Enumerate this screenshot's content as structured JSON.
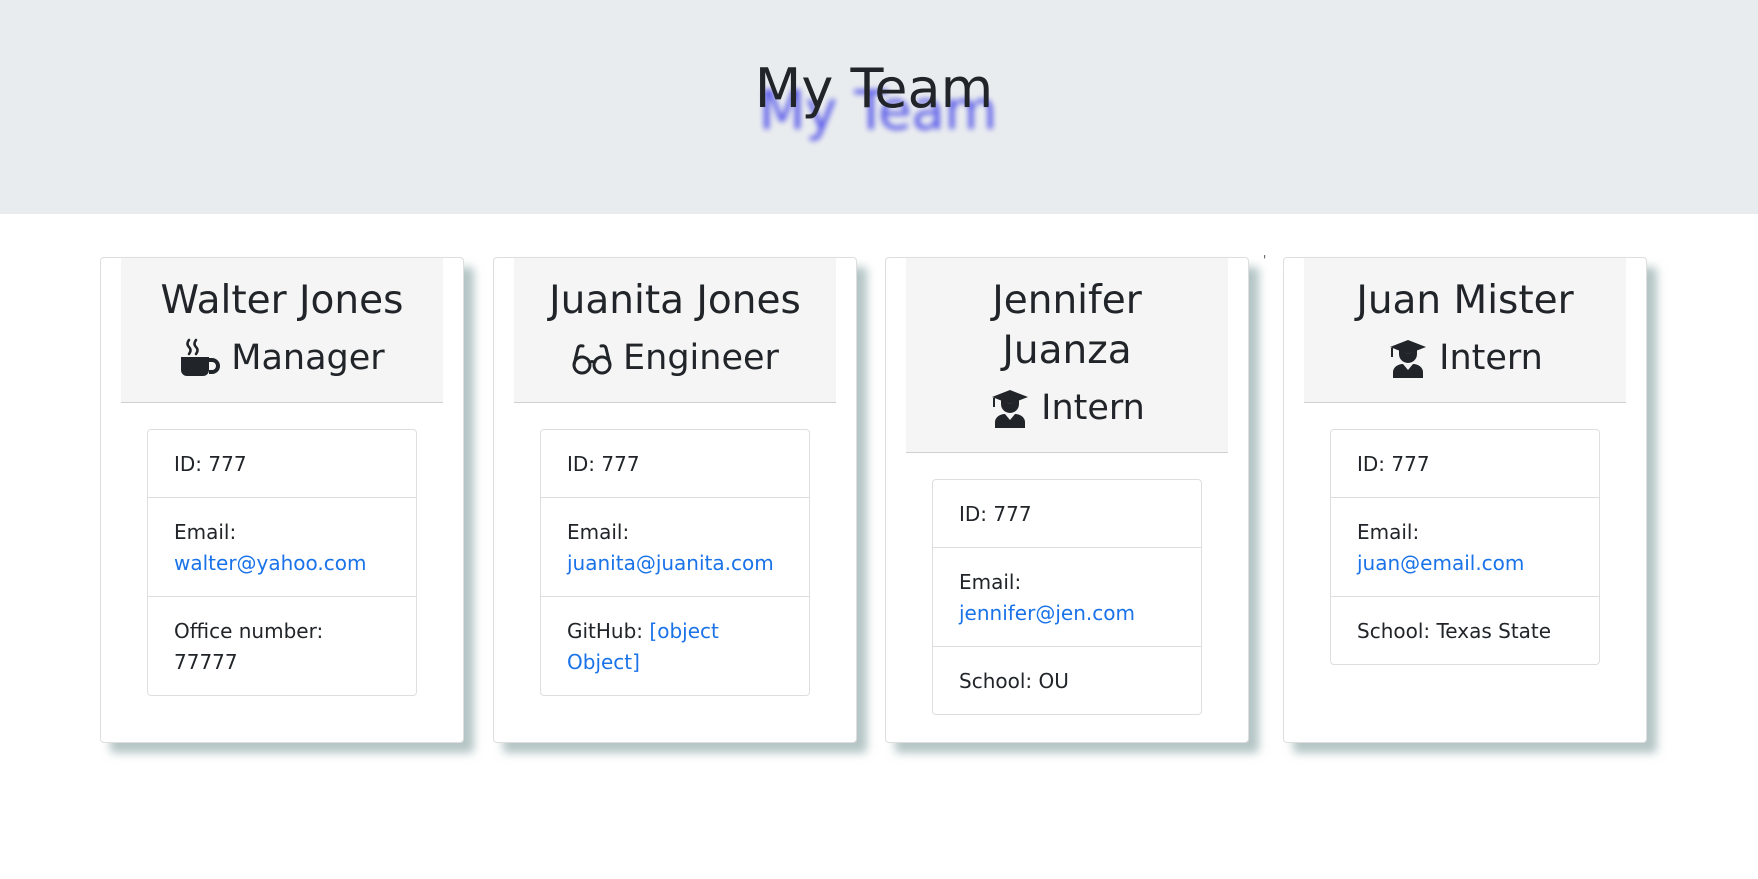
{
  "header": {
    "title": "My Team"
  },
  "employees": [
    {
      "name": "Walter Jones",
      "role": "Manager",
      "role_icon": "mug-hot-icon",
      "id_label": "ID: 777",
      "email_label": "Email:",
      "email": "walter@yahoo.com",
      "extra_label": "Office number: 77777",
      "extra_link": ""
    },
    {
      "name": "Juanita Jones",
      "role": "Engineer",
      "role_icon": "glasses-icon",
      "id_label": "ID: 777",
      "email_label": "Email:",
      "email": "juanita@juanita.com",
      "extra_label": "GitHub:",
      "extra_link": "[object Object]"
    },
    {
      "name": "Jennifer Juanza",
      "role": "Intern",
      "role_icon": "user-graduate-icon",
      "id_label": "ID: 777",
      "email_label": "Email:",
      "email": "jennifer@jen.com",
      "extra_label": "School: OU",
      "extra_link": ""
    },
    {
      "name": "Juan Mister",
      "role": "Intern",
      "role_icon": "user-graduate-icon",
      "id_label": "ID: 777",
      "email_label": "Email:",
      "email": "juan@email.com",
      "extra_label": "School: Texas State",
      "extra_link": ""
    }
  ],
  "stray_mark": "'",
  "colors": {
    "header_bg": "#e9ecef",
    "card_header_bg": "#f5f5f5",
    "link": "#1a73e8",
    "title_shadow": "#2a2ae8",
    "text": "#212529"
  }
}
